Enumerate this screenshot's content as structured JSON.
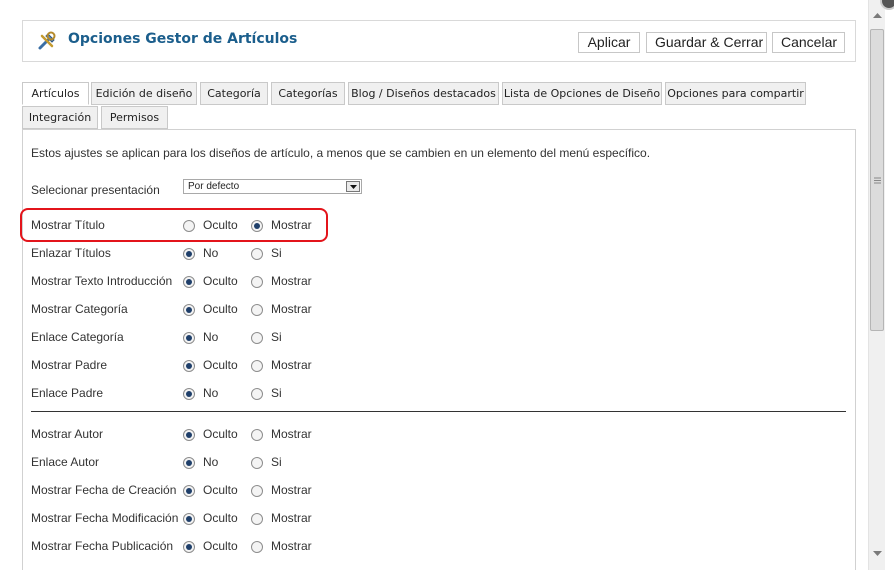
{
  "header": {
    "title": "Opciones Gestor de Artículos",
    "icon": "tools-icon",
    "buttons": {
      "apply": "Aplicar",
      "save_close": "Guardar & Cerrar",
      "cancel": "Cancelar"
    }
  },
  "tabs": [
    "Artículos",
    "Edición de diseño",
    "Categoría",
    "Categorías",
    "Blog / Diseños destacados",
    "Lista de Opciones de Diseño",
    "Opciones para compartir",
    "Integración",
    "Permisos"
  ],
  "active_tab": "Artículos",
  "intro_text": "Estos ajustes se aplican para los diseños de artículo, a menos que se cambien en un elemento del menú específico.",
  "layout_select": {
    "label": "Selecionar presentación",
    "value": "Por defecto"
  },
  "options": [
    {
      "label": "Mostrar Título",
      "choices": [
        "Oculto",
        "Mostrar"
      ],
      "selected": "Mostrar"
    },
    {
      "label": "Enlazar Títulos",
      "choices": [
        "No",
        "Si"
      ],
      "selected": "No"
    },
    {
      "label": "Mostrar Texto Introducción",
      "choices": [
        "Oculto",
        "Mostrar"
      ],
      "selected": "Oculto"
    },
    {
      "label": "Mostrar Categoría",
      "choices": [
        "Oculto",
        "Mostrar"
      ],
      "selected": "Oculto"
    },
    {
      "label": "Enlace Categoría",
      "choices": [
        "No",
        "Si"
      ],
      "selected": "No"
    },
    {
      "label": "Mostrar Padre",
      "choices": [
        "Oculto",
        "Mostrar"
      ],
      "selected": "Oculto"
    },
    {
      "label": "Enlace Padre",
      "choices": [
        "No",
        "Si"
      ],
      "selected": "No"
    },
    {
      "label": "Mostrar Autor",
      "choices": [
        "Oculto",
        "Mostrar"
      ],
      "selected": "Oculto"
    },
    {
      "label": "Enlace Autor",
      "choices": [
        "No",
        "Si"
      ],
      "selected": "No"
    },
    {
      "label": "Mostrar Fecha de Creación",
      "choices": [
        "Oculto",
        "Mostrar"
      ],
      "selected": "Oculto"
    },
    {
      "label": "Mostrar Fecha Modificación",
      "choices": [
        "Oculto",
        "Mostrar"
      ],
      "selected": "Oculto"
    },
    {
      "label": "Mostrar Fecha Publicación",
      "choices": [
        "Oculto",
        "Mostrar"
      ],
      "selected": "Oculto"
    }
  ],
  "colors": {
    "title": "#1b5e8c",
    "highlight": "#e3141b",
    "radio_selected": "#1f3f6a"
  }
}
